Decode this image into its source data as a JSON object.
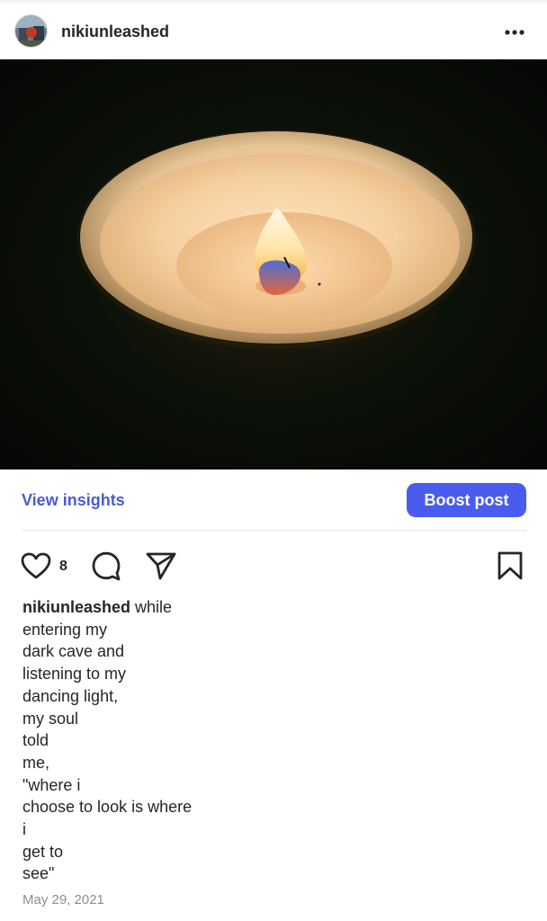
{
  "post": {
    "username": "nikiunleashed",
    "avatar_icon": "profile-avatar",
    "more_icon": "more-horizontal-icon",
    "image_description": "candle-photo"
  },
  "insights": {
    "view_insights_label": "View insights",
    "boost_label": "Boost post",
    "accent_color": "#4a5cf0"
  },
  "actions": {
    "like_icon": "heart-icon",
    "like_count": "8",
    "comment_icon": "comment-icon",
    "share_icon": "send-icon",
    "save_icon": "bookmark-icon"
  },
  "caption": {
    "username": "nikiunleashed",
    "lines": [
      " while",
      "entering my",
      "dark cave and",
      "listening to my",
      "dancing light,",
      "my soul",
      "told",
      "me,",
      "\"where i",
      "choose to look is where",
      "i",
      "get to",
      "see\""
    ]
  },
  "date": "May 29, 2021"
}
